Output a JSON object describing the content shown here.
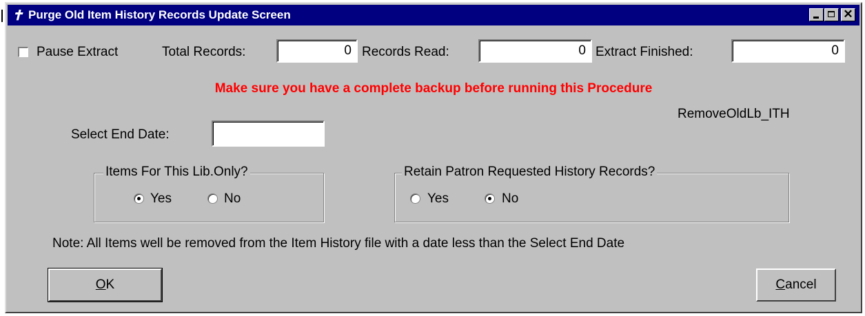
{
  "window": {
    "title": "Purge Old Item History Records Update Screen",
    "app_icon": "runner-icon",
    "controls": [
      "minimize-icon",
      "maximize-icon",
      "close-icon"
    ]
  },
  "extract": {
    "pause_label": "Pause Extract",
    "pause_checked": false,
    "total_records_label": "Total Records:",
    "total_records_value": "0",
    "records_read_label": "Records Read:",
    "records_read_value": "0",
    "extract_finished_label": "Extract Finished:",
    "extract_finished_value": "0"
  },
  "warning_text": "Make sure you have a complete backup before running this Procedure",
  "procedure_name": "RemoveOldLb_ITH",
  "end_date": {
    "label": "Select End Date:",
    "value": ""
  },
  "items_lib_group": {
    "legend": "Items For This Lib.Only?",
    "yes_label": "Yes",
    "no_label": "No",
    "selected": "Yes"
  },
  "retain_group": {
    "legend": "Retain Patron Requested History Records?",
    "yes_label": "Yes",
    "no_label": "No",
    "selected": "No"
  },
  "note_text": "Note: All Items well be removed from the Item History file with a date less than the Select End Date",
  "buttons": {
    "ok_accel": "O",
    "ok_rest": "K",
    "cancel_accel": "C",
    "cancel_rest": "ancel"
  },
  "colors": {
    "titlebar": "#000080",
    "window_face": "#c0c0c0",
    "warning": "#ff0000"
  }
}
